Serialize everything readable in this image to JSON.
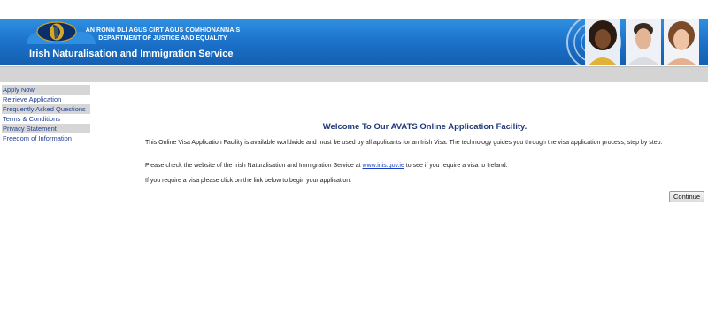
{
  "header": {
    "line1": "AN RONN DLÍ AGUS CIRT AGUS COMHIONANNAIS",
    "line2": "DEPARTMENT OF JUSTICE AND EQUALITY",
    "service": "Irish Naturalisation and Immigration Service",
    "brand_color": "#1a6fc7"
  },
  "nav": {
    "items": [
      {
        "label": "Apply Now"
      },
      {
        "label": "Retrieve Application"
      },
      {
        "label": "Frequently Asked Questions"
      },
      {
        "label": "Terms & Conditions"
      },
      {
        "label": "Privacy Statement"
      },
      {
        "label": "Freedom of Information"
      }
    ]
  },
  "main": {
    "heading": "Welcome To Our AVATS Online Application Facility.",
    "para1": "This Online Visa Application Facility is available worldwide and must be used by all applicants for an Irish Visa. The technology guides you through the visa application process, step by step.",
    "para2_before": "Please check the website of the Irish Naturalisation and Immigration Service at ",
    "para2_link": "www.inis.gov.ie",
    "para2_after": " to see if you require a visa to Ireland.",
    "para3": "If you require a visa please click on the link below to begin your application.",
    "continue_label": "Continue"
  }
}
